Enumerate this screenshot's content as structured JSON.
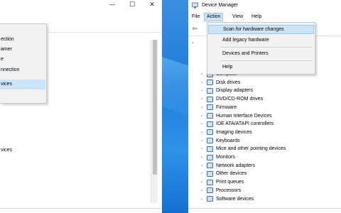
{
  "left_window": {
    "caption_buttons": [
      "—",
      "☐",
      "✕"
    ],
    "menu_items": [
      {
        "label": "ection",
        "highlighted": false
      },
      {
        "label": "amer",
        "highlighted": false
      },
      {
        "label": "e",
        "highlighted": false
      },
      {
        "label": "nnection",
        "highlighted": false
      },
      {
        "label": "vices",
        "highlighted": true
      }
    ],
    "list_fragment": "vices"
  },
  "device_manager": {
    "title": "Device Manager",
    "menubar": [
      "File",
      "Action",
      "View",
      "Help"
    ],
    "open_menu": "Action",
    "toolbar_icons": [
      "back-arrow-icon"
    ],
    "action_menu": [
      {
        "label": "Scan for hardware changes",
        "highlighted": true
      },
      {
        "label": "Add legacy hardware",
        "highlighted": false
      },
      {
        "label": "Devices and Printers",
        "highlighted": false
      },
      {
        "label": "Help",
        "highlighted": false
      }
    ],
    "tree_items": [
      "Computer",
      "Disk drives",
      "Display adapters",
      "DVD/CD-ROM drives",
      "Firmware",
      "Human Interface Devices",
      "IDE ATA/ATAPI controllers",
      "Imaging devices",
      "Keyboards",
      "Mice and other pointing devices",
      "Monitors",
      "Network adapters",
      "Other devices",
      "Print queues",
      "Processors",
      "Software devices"
    ]
  }
}
